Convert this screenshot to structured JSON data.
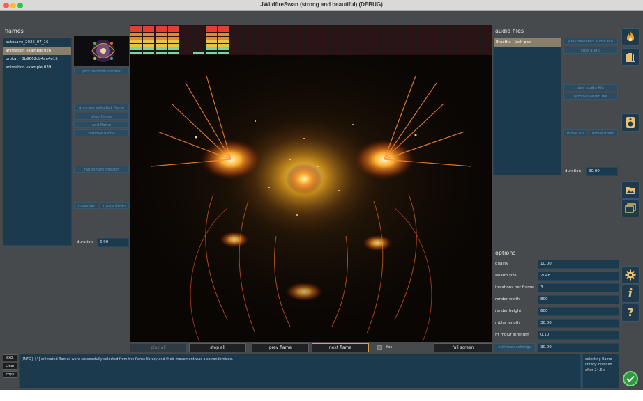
{
  "window": {
    "title": "JWildfireSwan (strong and beautiful) (DEBUG)"
  },
  "flames": {
    "label": "flames",
    "items": [
      {
        "label": "autosave_2025_07_16",
        "selected": false
      },
      {
        "label": "animation example 026",
        "selected": true
      },
      {
        "label": "brokat - 3b9662cb4aa4e15",
        "selected": false
      },
      {
        "label": "animation example 039",
        "selected": false
      }
    ],
    "pick_random": "pick random flames",
    "animate_selected": "animate selected flame",
    "stop_flame": "stop flame",
    "add_flame": "add flame",
    "remove_flame": "remove flame",
    "randomize_motion": "randomize motion",
    "move_up": "move up",
    "move_down": "move down",
    "duration_label": "duration",
    "duration_value": "6.90"
  },
  "audio": {
    "label": "audio files",
    "items": [
      {
        "label": "Breatha - Josh pan",
        "selected": true
      }
    ],
    "play_selected": "play selected audio file",
    "stop_audio": "stop audio",
    "add_audio": "add audio file",
    "remove_audio": "remove audio file",
    "move_up": "move up",
    "move_down": "move down",
    "duration_label": "duration",
    "duration_value": "30.00"
  },
  "options": {
    "label": "options",
    "rows": [
      {
        "label": "quality",
        "value": "10.00"
      },
      {
        "label": "swarm size",
        "value": "2048"
      },
      {
        "label": "iterations per frame",
        "value": "3"
      },
      {
        "label": "render width",
        "value": "800"
      },
      {
        "label": "render height",
        "value": "600"
      },
      {
        "label": "mblur length",
        "value": "30.00"
      },
      {
        "label": "fft mblur strength",
        "value": "0.10"
      }
    ],
    "optimize_label": "optimize settings",
    "optimize_value": "30.00"
  },
  "playback": {
    "play_all": "play all",
    "stop_all": "stop all",
    "prev_flame": "prev flame",
    "next_flame": "next flame",
    "fps_label": "fps",
    "full_screen": "full screen"
  },
  "spectrum": {
    "levels": [
      0.95,
      0.95,
      0.95,
      0.95,
      0.0,
      0.15,
      0.95,
      0.95,
      0.0,
      0.0,
      0.0,
      0.0,
      0.0,
      0.0,
      0.0,
      0.0,
      0.0,
      0.0,
      0.0,
      0.0,
      0.0,
      0.0,
      0.0,
      0.0,
      0.0,
      0.0,
      0.0,
      0.0,
      0.0
    ]
  },
  "log": {
    "message": "[INFO]: [4] animated flames were successfully selected from the flame library and their movement was also randomized.",
    "status_lines": [
      "selecting flame",
      "library: finished",
      "after 24.6 s"
    ],
    "exp": "exp.",
    "clear": "clear",
    "copy": "copy"
  },
  "icons": [
    "flame-icon",
    "organ-pipes-icon",
    "speaker-icon",
    "image-folder-icon",
    "gallery-icon",
    "gear-icon",
    "info-icon",
    "help-icon",
    "check-circle-icon"
  ],
  "colors": {
    "background": "#474a4c",
    "panel": "#1c3a4d",
    "selection": "#8a7f6a",
    "accent": "#d9a441",
    "success": "#2e9a3e"
  }
}
